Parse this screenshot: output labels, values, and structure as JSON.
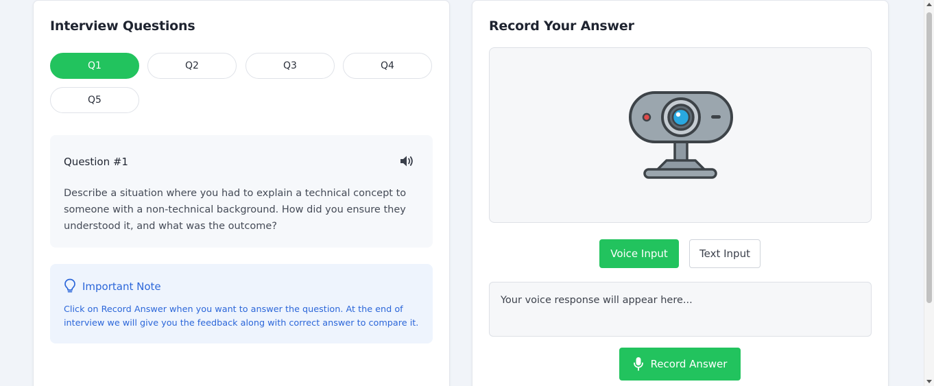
{
  "questions_panel": {
    "title": "Interview Questions",
    "tabs": [
      {
        "label": "Q1",
        "active": true
      },
      {
        "label": "Q2",
        "active": false
      },
      {
        "label": "Q3",
        "active": false
      },
      {
        "label": "Q4",
        "active": false
      },
      {
        "label": "Q5",
        "active": false
      }
    ],
    "question": {
      "heading": "Question #1",
      "text": "Describe a situation where you had to explain a technical concept to someone with a non-technical background. How did you ensure they understood it, and what was the outcome?",
      "speaker_icon": "speaker-icon"
    },
    "note": {
      "icon": "lightbulb-icon",
      "title": "Important Note",
      "text": "Click on Record Answer when you want to answer the question. At the end of interview we will give you the feedback along with correct answer to compare it."
    }
  },
  "answer_panel": {
    "title": "Record Your Answer",
    "webcam_icon": "webcam-icon",
    "voice_input_label": "Voice Input",
    "text_input_label": "Text Input",
    "response_placeholder": "Your voice response will appear here...",
    "record_button_label": "Record Answer",
    "mic_icon": "microphone-icon"
  },
  "colors": {
    "accent_green": "#22c35e",
    "note_blue": "#2b66d9",
    "note_background": "#eef4fd",
    "page_background": "#f1f4f9"
  }
}
